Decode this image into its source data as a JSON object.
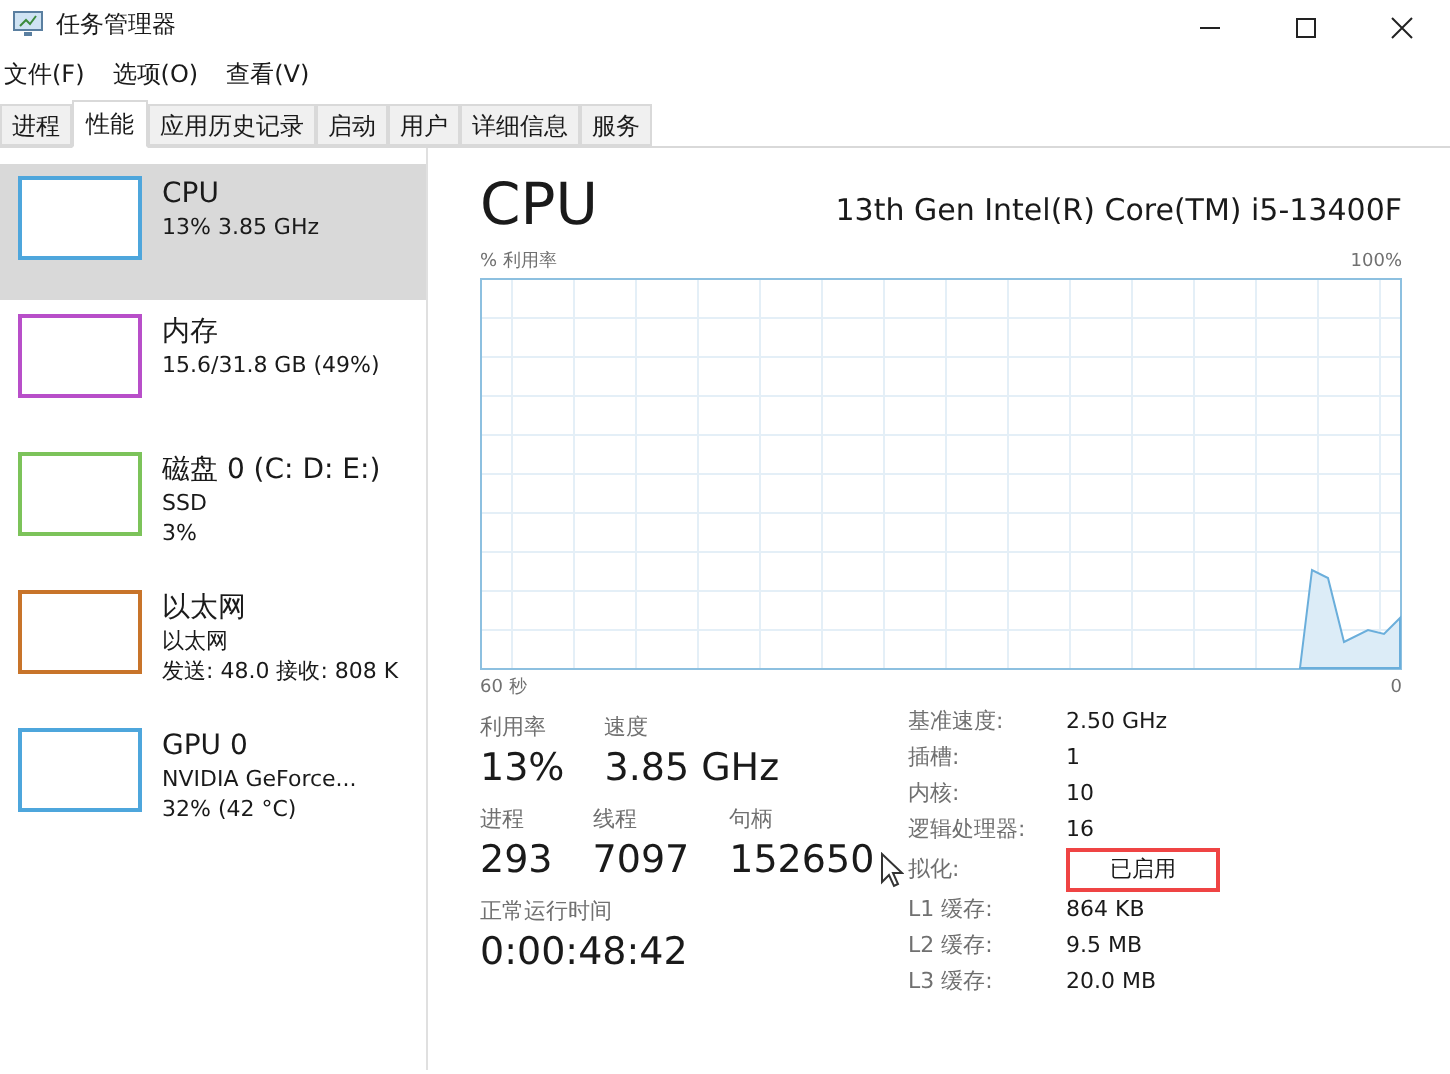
{
  "window": {
    "title": "任务管理器"
  },
  "menu": [
    "文件(F)",
    "选项(O)",
    "查看(V)"
  ],
  "tabs": [
    {
      "label": "进程",
      "selected": false
    },
    {
      "label": "性能",
      "selected": true
    },
    {
      "label": "应用历史记录",
      "selected": false
    },
    {
      "label": "启动",
      "selected": false
    },
    {
      "label": "用户",
      "selected": false
    },
    {
      "label": "详细信息",
      "selected": false
    },
    {
      "label": "服务",
      "selected": false
    }
  ],
  "sidebar": {
    "items": [
      {
        "name": "CPU",
        "lines": [
          "13% 3.85 GHz"
        ],
        "color": "#4ea6dc",
        "selected": true
      },
      {
        "name": "内存",
        "lines": [
          "15.6/31.8 GB (49%)"
        ],
        "color": "#b84fc9",
        "selected": false
      },
      {
        "name": "磁盘 0 (C: D: E:)",
        "lines": [
          "SSD",
          "3%"
        ],
        "color": "#7cc35a",
        "selected": false
      },
      {
        "name": "以太网",
        "lines": [
          "以太网",
          "发送: 48.0 接收: 808 K"
        ],
        "color": "#c8742a",
        "selected": false
      },
      {
        "name": "GPU 0",
        "lines": [
          "NVIDIA GeForce...",
          "32% (42 °C)"
        ],
        "color": "#4ea6dc",
        "selected": false
      }
    ]
  },
  "detail": {
    "title": "CPU",
    "model": "13th Gen Intel(R) Core(TM) i5-13400F",
    "graph": {
      "ylabel": "% 利用率",
      "ymax": "100%",
      "xlabel": "60 秒",
      "xmin": "0"
    },
    "stats": [
      [
        {
          "label": "利用率",
          "value": "13%"
        },
        {
          "label": "速度",
          "value": "3.85 GHz"
        }
      ],
      [
        {
          "label": "进程",
          "value": "293"
        },
        {
          "label": "线程",
          "value": "7097"
        },
        {
          "label": "句柄",
          "value": "152650"
        }
      ],
      [
        {
          "label": "正常运行时间",
          "value": "0:00:48:42"
        }
      ]
    ],
    "specs": [
      {
        "label": "基准速度:",
        "value": "2.50 GHz",
        "highlighted": false
      },
      {
        "label": "插槽:",
        "value": "1",
        "highlighted": false
      },
      {
        "label": "内核:",
        "value": "10",
        "highlighted": false
      },
      {
        "label": "逻辑处理器:",
        "value": "16",
        "highlighted": false
      },
      {
        "label": "拟化:",
        "value": "已启用",
        "highlighted": true
      },
      {
        "label": "L1 缓存:",
        "value": "864 KB",
        "highlighted": false
      },
      {
        "label": "L2 缓存:",
        "value": "9.5 MB",
        "highlighted": false
      },
      {
        "label": "L3 缓存:",
        "value": "20.0 MB",
        "highlighted": false
      }
    ]
  }
}
